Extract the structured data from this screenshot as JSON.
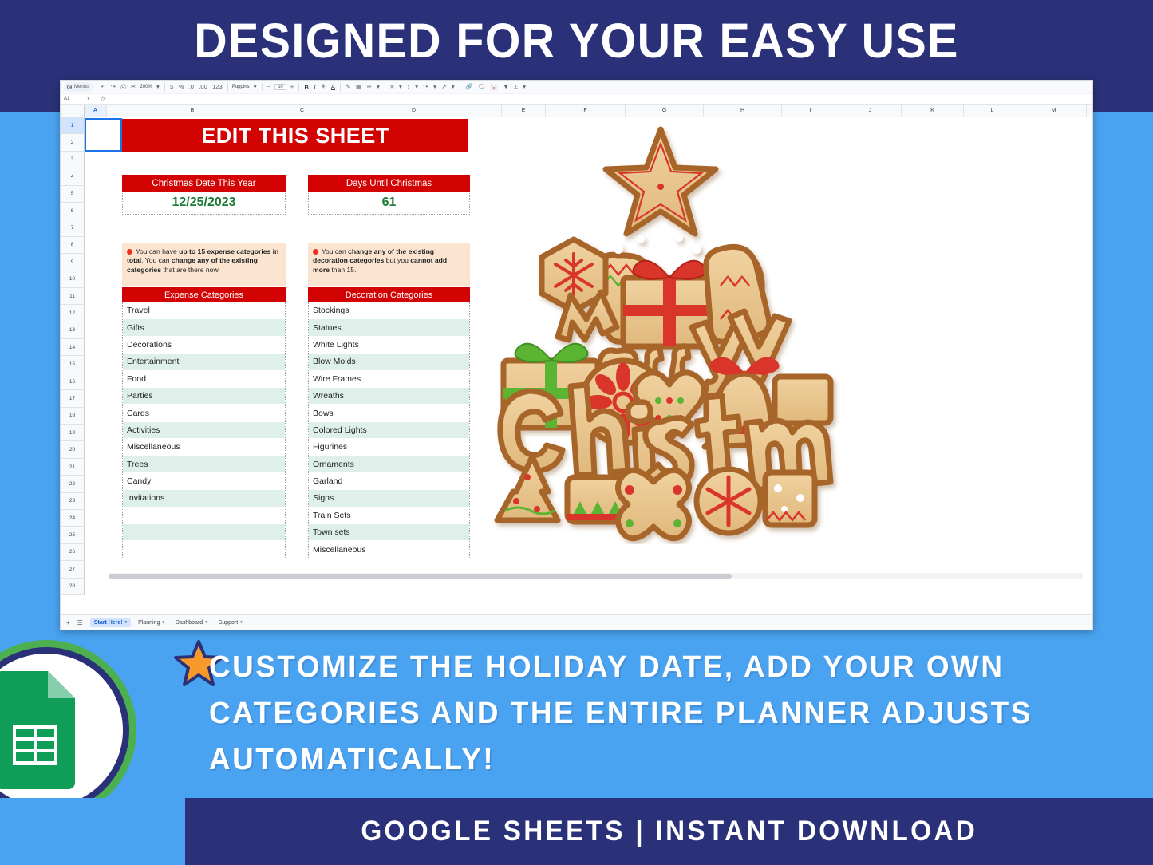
{
  "header": {
    "title": "DESIGNED FOR YOUR EASY USE"
  },
  "promo": {
    "middle_text": "CUSTOMIZE THE HOLIDAY DATE, ADD YOUR OWN CATEGORIES AND THE ENTIRE PLANNER ADJUSTS AUTOMATICALLY!",
    "footer_text": "GOOGLE SHEETS | INSTANT DOWNLOAD",
    "star_icon": "star-icon",
    "logo_icon": "google-sheets-logo"
  },
  "colors": {
    "navy": "#2b3178",
    "sky_blue": "#4aa3f0",
    "red": "#d30303",
    "green_text": "#1a7a36",
    "note_bg": "#fbe5d0",
    "row_alt": "#dff0ea",
    "sheets_green": "#0f9d58"
  },
  "spreadsheet": {
    "toolbar": {
      "search_label": "Menus",
      "search_icon": "search-icon",
      "undo_icon": "undo-icon",
      "redo_icon": "redo-icon",
      "print_icon": "print-icon",
      "paint_format_icon": "paint-format-icon",
      "zoom_value": "200%",
      "currency_icon": "currency-icon",
      "percent_icon": "percent-icon",
      "decimal_decrease_icon": "decimal-decrease-icon",
      "decimal_increase_icon": "decimal-increase-icon",
      "more_formats_icon": "more-formats-icon",
      "font_family": "Poppins",
      "font_size_decrease": "−",
      "font_size": "10",
      "font_size_increase": "+",
      "bold_label": "B",
      "italic_label": "I",
      "strikethrough_icon": "strikethrough-icon",
      "text_color_label": "A",
      "fill_color_icon": "fill-color-icon",
      "borders_icon": "borders-icon",
      "merge_cells_icon": "merge-cells-icon",
      "halign_icon": "horizontal-align-icon",
      "valign_icon": "vertical-align-icon",
      "wrap_icon": "text-wrap-icon",
      "rotate_icon": "text-rotation-icon",
      "link_icon": "insert-link-icon",
      "comment_icon": "insert-comment-icon",
      "chart_icon": "insert-chart-icon",
      "filter_icon": "filter-icon",
      "functions_icon": "functions-icon",
      "more_icon": "more-options-icon"
    },
    "formula_bar": {
      "cell_reference": "A1",
      "fx_label": "fx",
      "formula_value": ""
    },
    "columns": [
      "A",
      "B",
      "C",
      "D",
      "E",
      "F",
      "G",
      "H",
      "I",
      "J",
      "K",
      "L",
      "M"
    ],
    "rows": [
      "1",
      "2",
      "3",
      "4",
      "5",
      "6",
      "7",
      "8",
      "9",
      "10",
      "11",
      "12",
      "13",
      "14",
      "15",
      "16",
      "17",
      "18",
      "19",
      "20",
      "21",
      "22",
      "23",
      "24",
      "25",
      "26",
      "27",
      "28"
    ],
    "banner": "EDIT THIS SHEET",
    "stats": [
      {
        "label": "Christmas Date This Year",
        "value": "12/25/2023"
      },
      {
        "label": "Days Until Christmas",
        "value": "61"
      }
    ],
    "notes": [
      {
        "parts": [
          {
            "t": "You can have ",
            "b": false
          },
          {
            "t": "up to 15 expense categories in total",
            "b": true
          },
          {
            "t": ". You can ",
            "b": false
          },
          {
            "t": "change any of the existing categories",
            "b": true
          },
          {
            "t": " that are there now.",
            "b": false
          }
        ]
      },
      {
        "parts": [
          {
            "t": "You can ",
            "b": false
          },
          {
            "t": "change any of the existing decoration categories",
            "b": true
          },
          {
            "t": " but you ",
            "b": false
          },
          {
            "t": "cannot add more",
            "b": true
          },
          {
            "t": " than 15.",
            "b": false
          }
        ]
      }
    ],
    "lists": [
      {
        "header": "Expense Categories",
        "items": [
          "Travel",
          "Gifts",
          "Decorations",
          "Entertainment",
          "Food",
          "Parties",
          "Cards",
          "Activities",
          "Miscellaneous",
          "Trees",
          "Candy",
          "Invitations",
          "",
          "",
          ""
        ]
      },
      {
        "header": "Decoration Categories",
        "items": [
          "Stockings",
          "Statues",
          "White Lights",
          "Blow Molds",
          "Wire Frames",
          "Wreaths",
          "Bows",
          "Colored Lights",
          "Figurines",
          "Ornaments",
          "Garland",
          "Signs",
          "Train Sets",
          "Town sets",
          "Miscellaneous"
        ]
      }
    ],
    "artwork": {
      "name": "gingerbread-christmas-tree",
      "text": "Merry Christmas"
    },
    "tabs": [
      {
        "label": "Start Here!",
        "active": true
      },
      {
        "label": "Planning",
        "active": false
      },
      {
        "label": "Dashboard",
        "active": false
      },
      {
        "label": "Support",
        "active": false
      }
    ],
    "tab_controls": {
      "add_sheet_icon": "add-sheet-icon",
      "all_sheets_icon": "all-sheets-icon"
    }
  }
}
